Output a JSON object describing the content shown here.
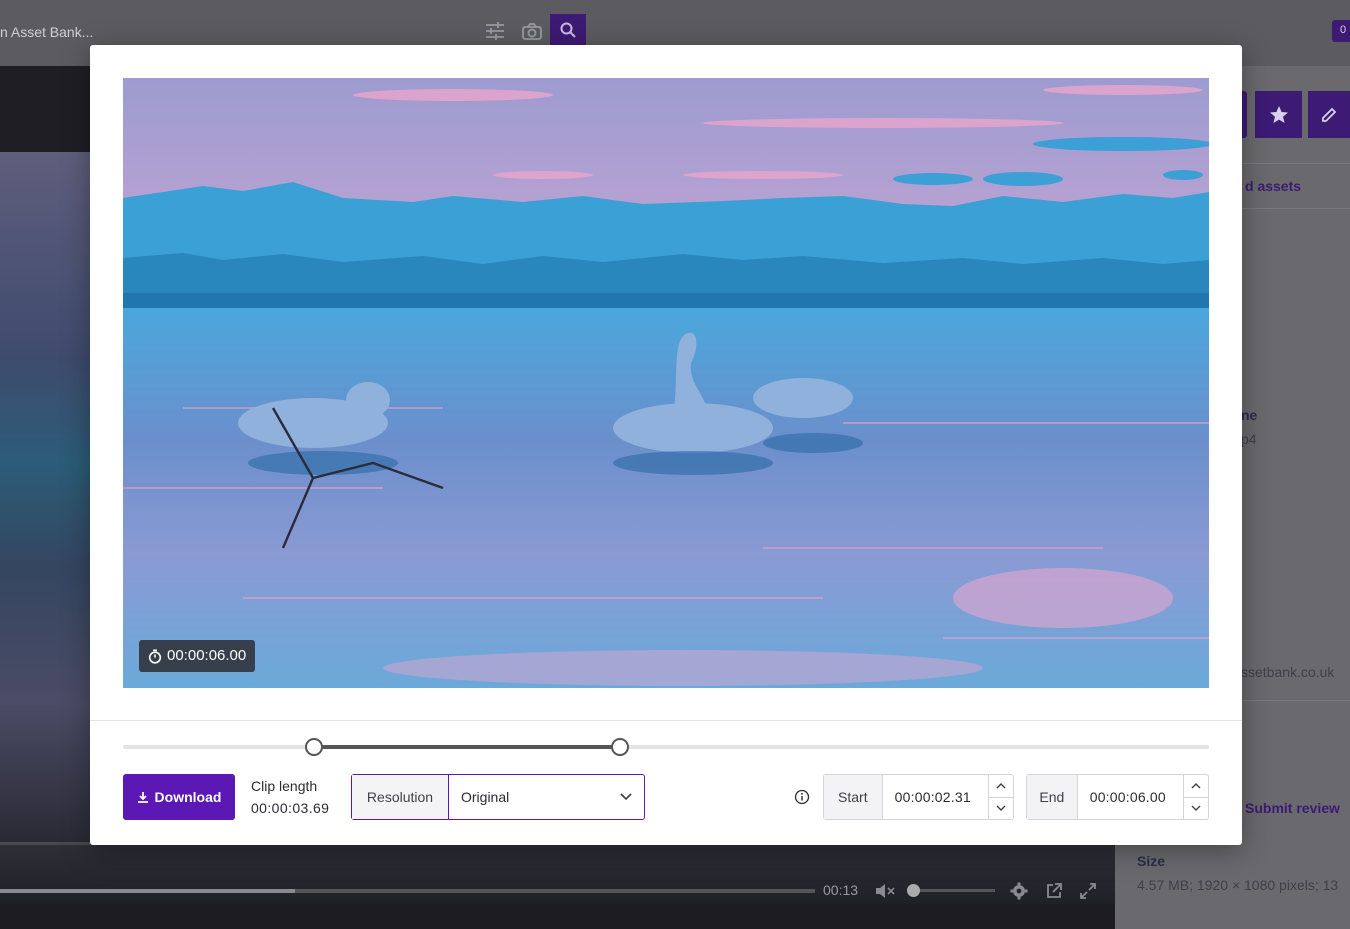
{
  "background": {
    "search_text": "n Asset Bank...",
    "cart_badge": "0",
    "related_text": "d assets",
    "filename_label": "ne",
    "filename_value": "p4",
    "email_text": "ssetbank.co.uk",
    "submit_review": "Submit review",
    "size_label": "Size",
    "size_value": "4.57 MB; 1920 × 1080 pixels; 13",
    "player_time": "00:13"
  },
  "modal": {
    "duration_badge": "00:00:06.00",
    "download_label": "Download",
    "clip_length_label": "Clip length",
    "clip_length_value": "00:00:03.69",
    "resolution_label": "Resolution",
    "resolution_value": "Original",
    "start_label": "Start",
    "start_value": "00:00:02.31",
    "end_label": "End",
    "end_value": "00:00:06.00",
    "total_duration_seconds": 6.0,
    "slider_start_fraction": 0.176,
    "slider_end_fraction": 0.458
  },
  "colors": {
    "accent": "#5b18b4",
    "overlay": "#4a4a4e"
  }
}
